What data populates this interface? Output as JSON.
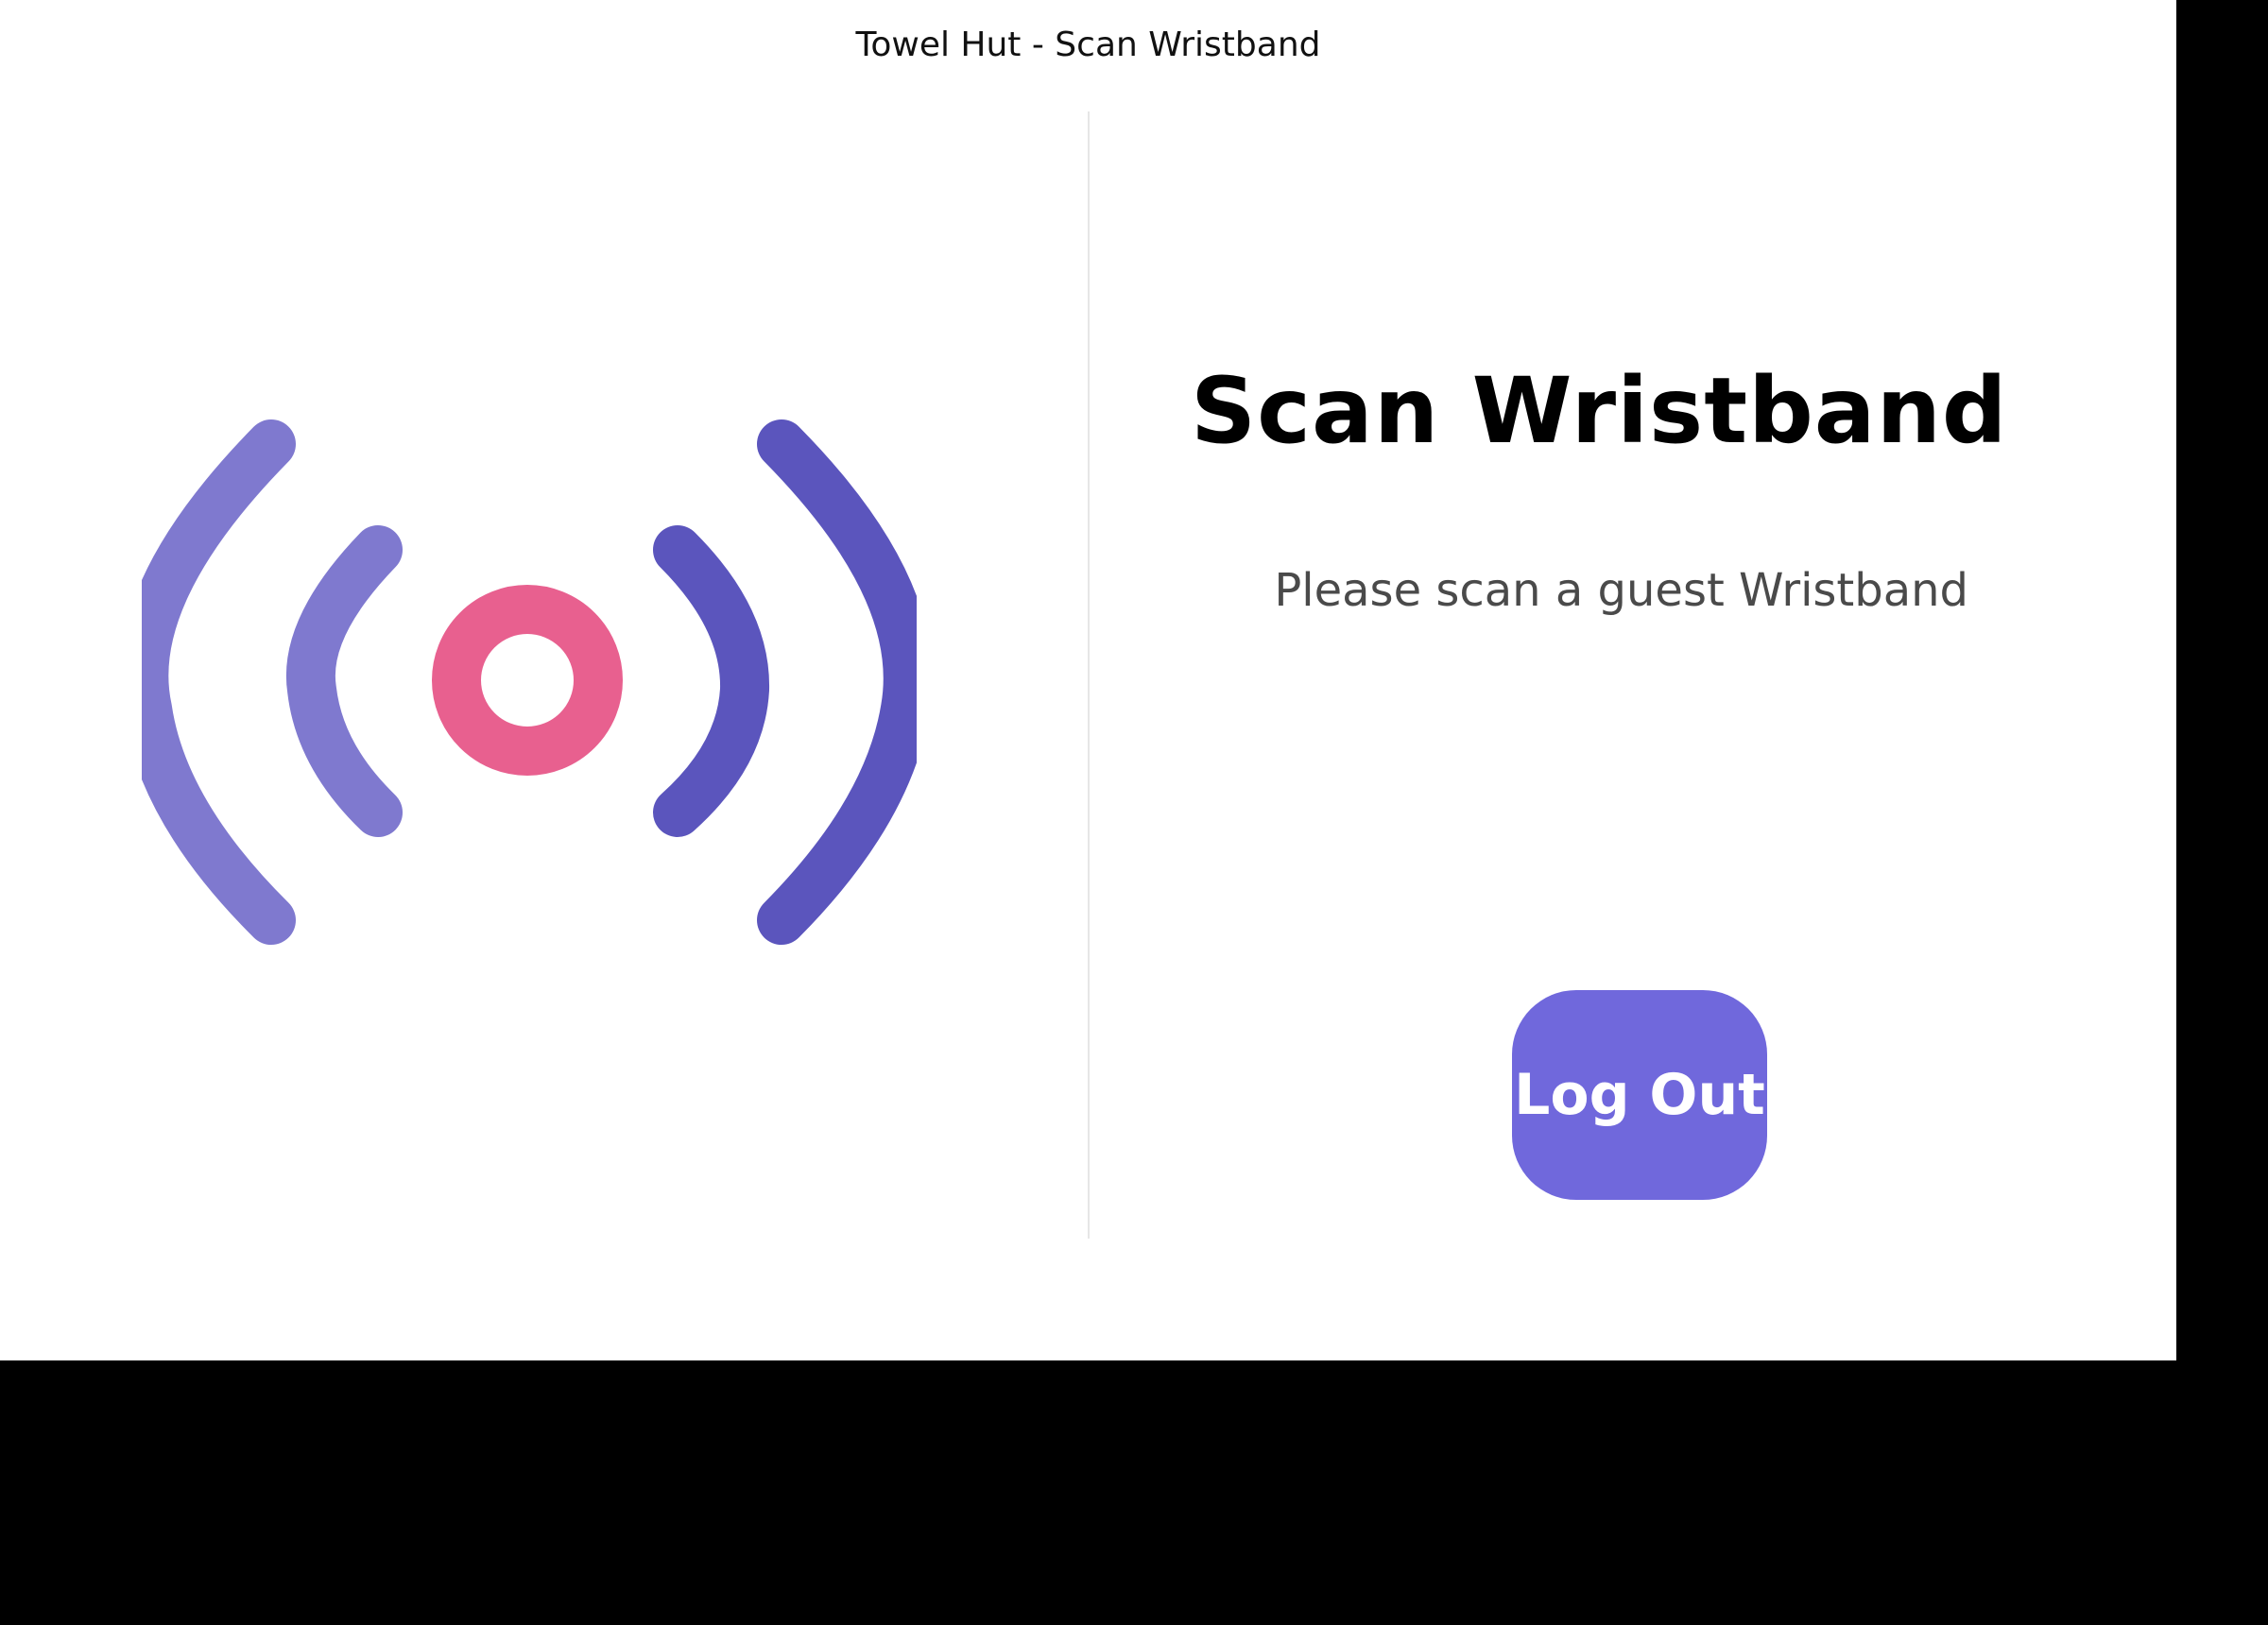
{
  "window": {
    "title": "Towel Hut - Scan Wristband"
  },
  "scanner": {
    "icon": "nfc-signal-icon",
    "colors": {
      "outer_left": "#7f79cf",
      "outer_right": "#5b55bd",
      "center": "#e8608f"
    }
  },
  "main": {
    "heading": "Scan Wristband",
    "instruction": "Please scan a guest Wristband",
    "logout_label": "Log Out"
  },
  "colors": {
    "button": "#7068dc",
    "heading": "#000000",
    "instruction": "#4a4a4a",
    "divider": "#e6e6e6"
  }
}
